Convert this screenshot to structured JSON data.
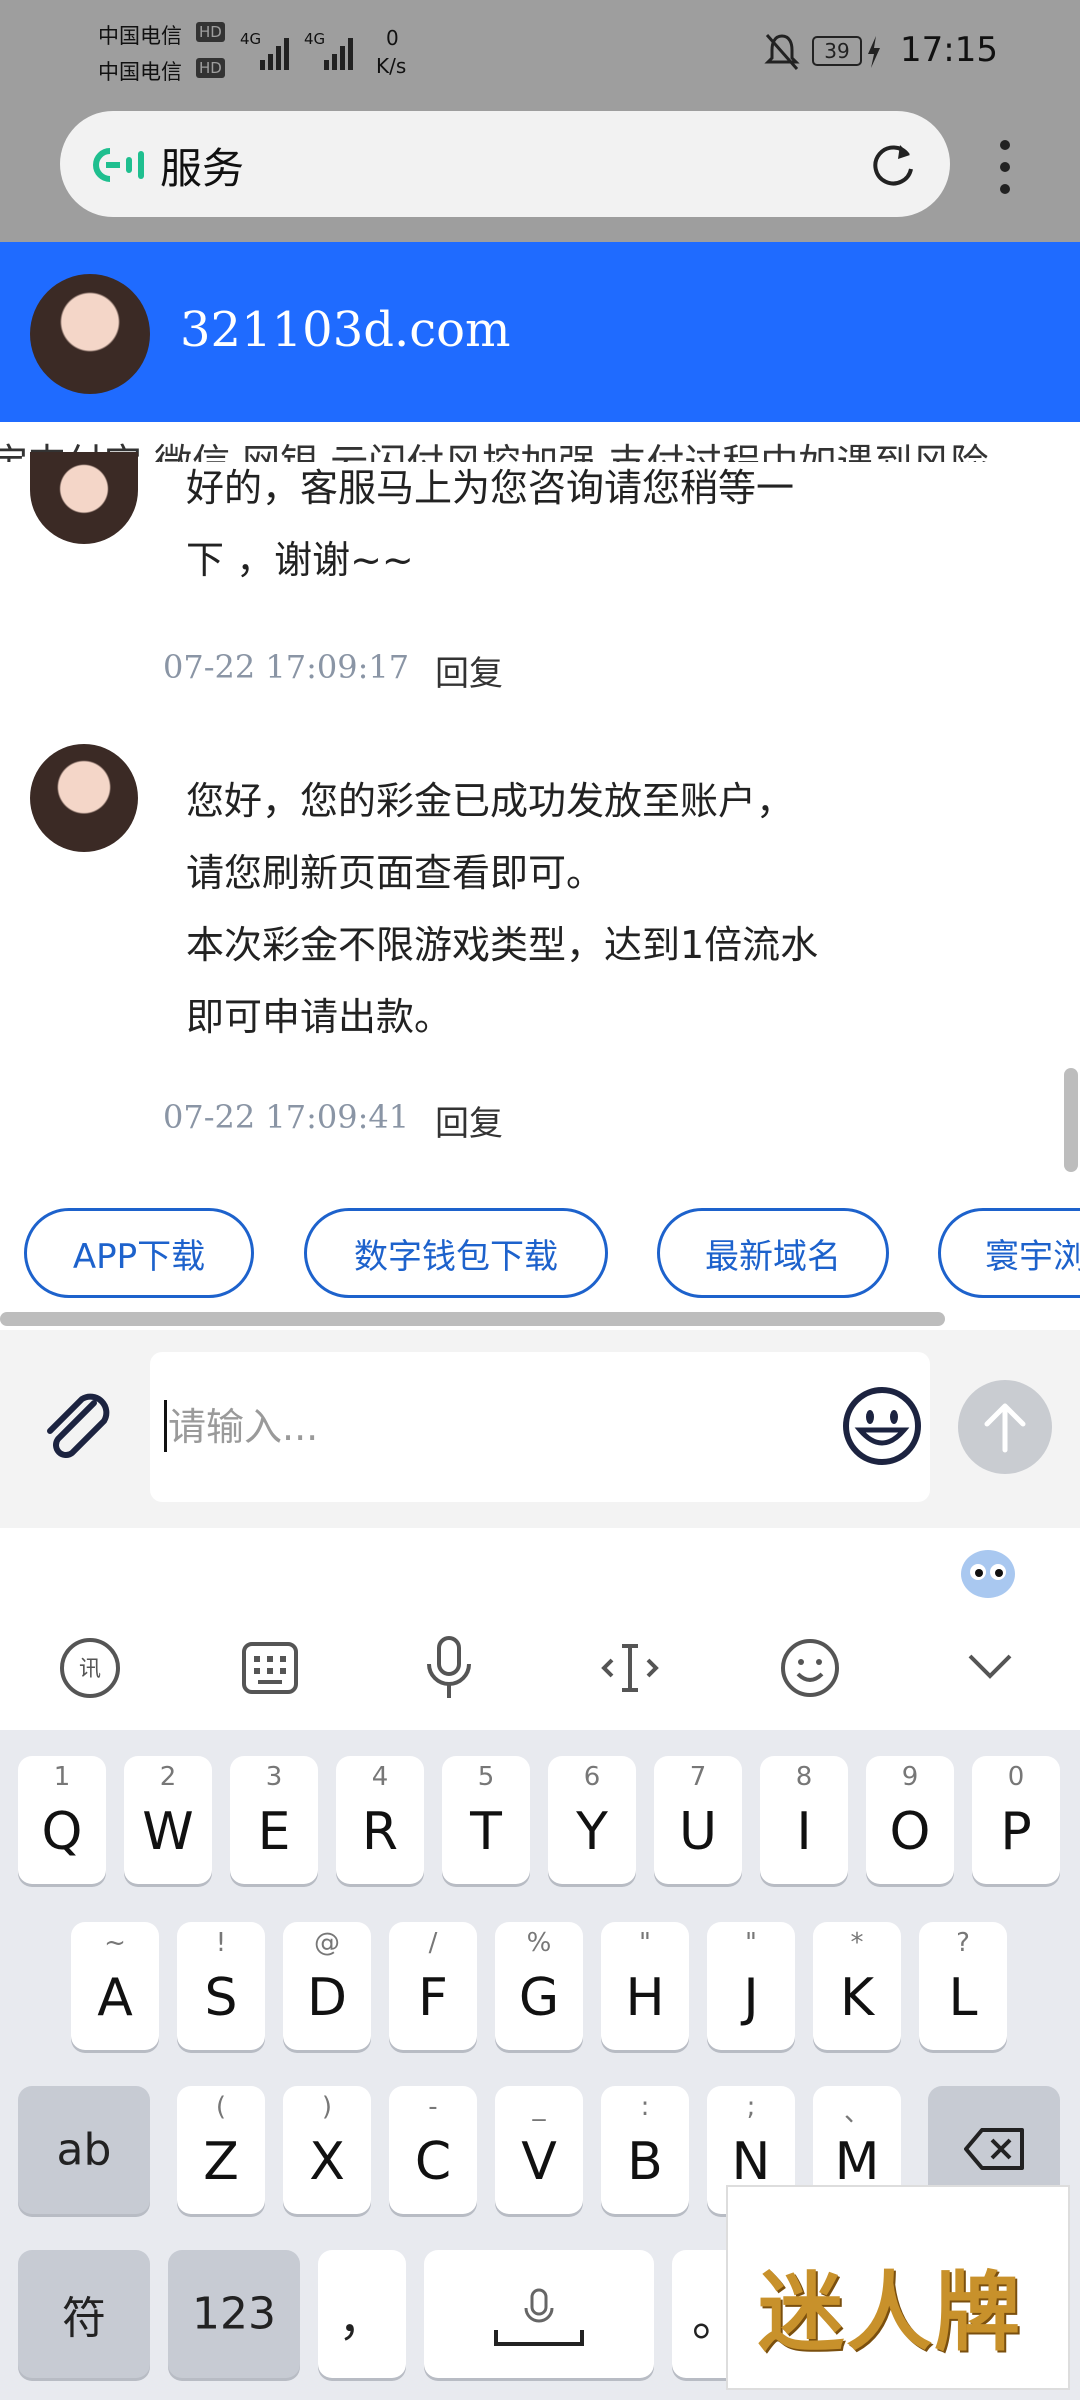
{
  "status_bar": {
    "carrier1": "中国电信",
    "carrier2": "中国电信",
    "hd_badge": "HD",
    "net1": "4G",
    "net2": "4G",
    "speed_value": "0",
    "speed_unit": "K/s",
    "battery": "39",
    "time": "17:15"
  },
  "browser": {
    "title": "服务",
    "icons": [
      "site-icon",
      "refresh-icon",
      "more-vert-icon"
    ]
  },
  "chat_header": {
    "title": "321103d.com"
  },
  "marquee": {
    "text": "宝支付宝   微信   网银   云闪付风控加强   支付过程中如遇到风险"
  },
  "messages": [
    {
      "lines": [
        "好的，客服马上为您咨询请您稍等一",
        "下 ，谢谢~~"
      ],
      "time": "07-22 17:09:17",
      "reply_label": "回复"
    },
    {
      "lines": [
        "您好，您的彩金已成功发放至账户，",
        "请您刷新页面查看即可。",
        "本次彩金不限游戏类型，达到1倍流水",
        "即可申请出款。"
      ],
      "time": "07-22 17:09:41",
      "reply_label": "回复"
    }
  ],
  "quick_actions": [
    "APP下载",
    "数字钱包下载",
    "最新域名",
    "寰宇浏"
  ],
  "input": {
    "placeholder": "请输入..."
  },
  "keyboard": {
    "row1": [
      {
        "main": "Q",
        "sub": "1"
      },
      {
        "main": "W",
        "sub": "2"
      },
      {
        "main": "E",
        "sub": "3"
      },
      {
        "main": "R",
        "sub": "4"
      },
      {
        "main": "T",
        "sub": "5"
      },
      {
        "main": "Y",
        "sub": "6"
      },
      {
        "main": "U",
        "sub": "7"
      },
      {
        "main": "I",
        "sub": "8"
      },
      {
        "main": "O",
        "sub": "9"
      },
      {
        "main": "P",
        "sub": "0"
      }
    ],
    "row2": [
      {
        "main": "A",
        "sub": "~"
      },
      {
        "main": "S",
        "sub": "!"
      },
      {
        "main": "D",
        "sub": "@"
      },
      {
        "main": "F",
        "sub": "/"
      },
      {
        "main": "G",
        "sub": "%"
      },
      {
        "main": "H",
        "sub": "\""
      },
      {
        "main": "J",
        "sub": "\""
      },
      {
        "main": "K",
        "sub": "*"
      },
      {
        "main": "L",
        "sub": "?"
      }
    ],
    "row3": [
      {
        "main": "Z",
        "sub": "("
      },
      {
        "main": "X",
        "sub": ")"
      },
      {
        "main": "C",
        "sub": "-"
      },
      {
        "main": "V",
        "sub": "_"
      },
      {
        "main": "B",
        "sub": ":"
      },
      {
        "main": "N",
        "sub": ";"
      },
      {
        "main": "M",
        "sub": "、"
      }
    ],
    "shift_label": "ab",
    "symbol_label": "符",
    "number_label": "123",
    "comma_label": "，",
    "period_label": "。"
  },
  "watermark": {
    "text": "迷人牌"
  }
}
